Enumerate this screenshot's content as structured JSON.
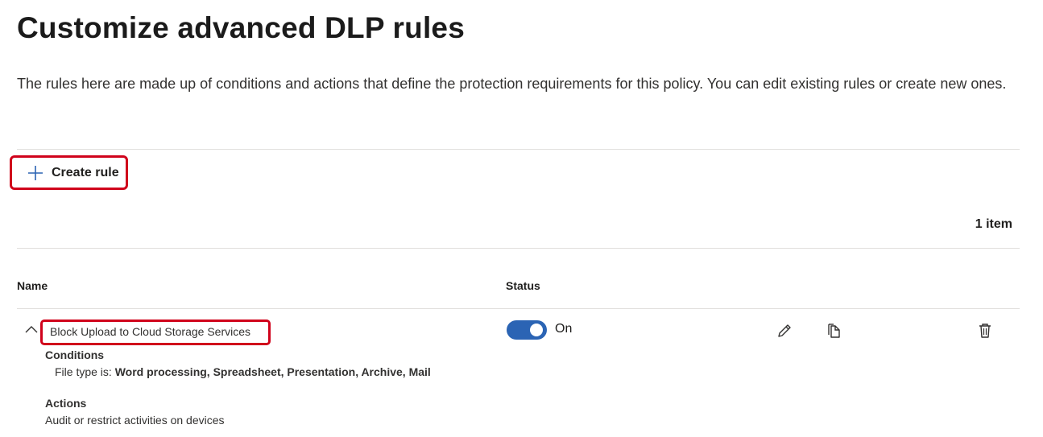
{
  "page": {
    "title": "Customize advanced DLP rules",
    "description": "The rules here are made up of conditions and actions that define the protection requirements for this policy. You can edit existing rules or create new ones."
  },
  "toolbar": {
    "create_rule_label": "Create rule",
    "create_icon": "plus-icon"
  },
  "list": {
    "count_label": "1 item",
    "columns": {
      "name": "Name",
      "status": "Status"
    },
    "rows": [
      {
        "name": "Block Upload to Cloud Storage Services",
        "status_label": "On",
        "status_on": true,
        "conditions_heading": "Conditions",
        "condition_prefix": "File type is: ",
        "condition_value": "Word processing, Spreadsheet, Presentation, Archive, Mail",
        "actions_heading": "Actions",
        "action_text": "Audit or restrict activities on devices",
        "icons": [
          "chevron-up-icon",
          "edit-icon",
          "copy-icon",
          "delete-icon"
        ]
      }
    ]
  },
  "colors": {
    "highlight": "#d0021b",
    "toggle_on": "#2b64b4",
    "divider": "#e1dfdd"
  }
}
